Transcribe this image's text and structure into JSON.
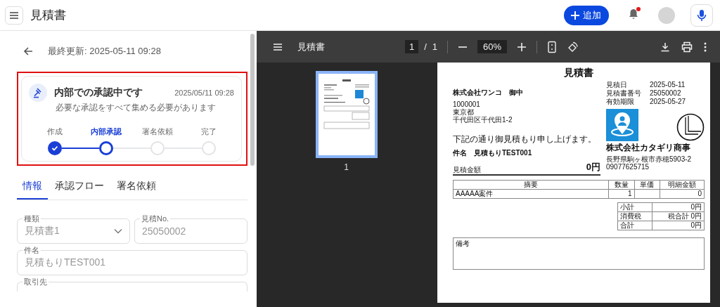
{
  "app_bar": {
    "title": "見積書",
    "add_button": "追加",
    "has_notification": true
  },
  "panel": {
    "last_updated": "最終更新: 2025-05-11 09:28",
    "status_card": {
      "title": "内部での承認中です",
      "timestamp": "2025/05/11 09:28",
      "description": "必要な承認をすべて集める必要があります",
      "steps": [
        {
          "label": "作成",
          "kind": "done"
        },
        {
          "label": "内部承認",
          "kind": "current"
        },
        {
          "label": "署名依頼",
          "kind": "pending"
        },
        {
          "label": "完了",
          "kind": "pending"
        }
      ]
    },
    "tabs": [
      {
        "label": "情報",
        "selected": true
      },
      {
        "label": "承認フロー",
        "selected": false
      },
      {
        "label": "署名依頼",
        "selected": false
      }
    ],
    "field_rows": [
      [
        {
          "label": "種類",
          "value": "見積書1",
          "kind": "select",
          "disabled": true
        },
        {
          "label": "見積No.",
          "value": "25050002",
          "kind": "text",
          "disabled": true
        }
      ],
      [
        {
          "label": "件名",
          "value": "見積もりTEST001",
          "kind": "text",
          "disabled": true
        }
      ],
      [
        {
          "label": "取引先",
          "kind": "text"
        }
      ]
    ]
  },
  "viewer": {
    "title": "見積書",
    "page": "1",
    "page_separator": "/",
    "page_count": "1",
    "zoom": "60%",
    "thumbnails": [
      {
        "page_label": "1",
        "selected": true
      }
    ],
    "document": {
      "title": "見積書",
      "recipient": "株式会社ワンコ　御中",
      "recipient_address": [
        "1000001",
        "東京都",
        "千代田区千代田1-2"
      ],
      "intro": "下記の通り御見積もり申し上げます。",
      "subject_label": "件名",
      "subject": "見積もりTEST001",
      "amount_label": "見積金額",
      "amount": "0円",
      "meta": [
        {
          "label": "見積日",
          "value": "2025-05-11"
        },
        {
          "label": "見積書番号",
          "value": "25050002"
        },
        {
          "label": "有効期限",
          "value": "2025-05-27"
        }
      ],
      "issuer_name": "株式会社カタギリ商事",
      "issuer_address": [
        "長野県駒ヶ根市赤穂5903-2",
        "09077625715"
      ],
      "columns": [
        "摘要",
        "数量",
        "単価",
        "明細金額"
      ],
      "items": [
        {
          "description": "AAAAA案件",
          "quantity": "1",
          "amount": "0"
        }
      ],
      "totals": [
        {
          "label": "小計",
          "value": "0円"
        },
        {
          "label": "消費税",
          "value": "税合計 0円"
        },
        {
          "label": "合計",
          "value": "0円"
        }
      ],
      "remarks_label": "備考"
    }
  }
}
